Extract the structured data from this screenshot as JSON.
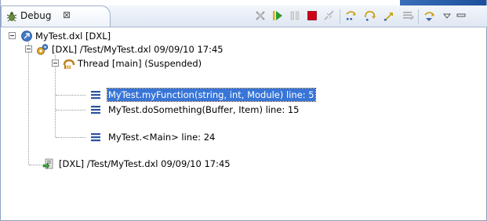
{
  "colors": {
    "selection": "#3875d7",
    "frame_border": "#8da2c0",
    "tabbar": "#dfe7f3",
    "terminate": "#d0021b",
    "resume": "#2e9a2e"
  },
  "view": {
    "tab_label": "Debug",
    "tab_close_glyph": "⊠"
  },
  "toolbar": {
    "buttons": [
      {
        "name": "remove-terminated-icon"
      },
      {
        "name": "resume-icon"
      },
      {
        "name": "suspend-icon"
      },
      {
        "name": "terminate-icon"
      },
      {
        "name": "disconnect-icon"
      },
      {
        "name": "step-into-icon"
      },
      {
        "name": "step-over-icon"
      },
      {
        "name": "step-return-icon"
      },
      {
        "name": "drop-to-frame-icon"
      },
      {
        "name": "use-step-filters-icon"
      },
      {
        "name": "view-menu-icon"
      },
      {
        "name": "minimize-icon"
      }
    ]
  },
  "tree": {
    "launch": {
      "label": "MyTest.dxl [DXL]",
      "icon": "launch-config-icon"
    },
    "debug_target": {
      "label": "[DXL] /Test/MyTest.dxl 09/09/10 17:45",
      "icon": "debug-target-icon"
    },
    "thread": {
      "label": "Thread [main] (Suspended)",
      "icon": "thread-suspended-icon"
    },
    "frames": [
      {
        "label": "MyTest.myFunction(string, int, Module) line: 5",
        "selected": true
      },
      {
        "label": "MyTest.doSomething(Buffer, Item) line: 15",
        "selected": false
      },
      {
        "label": "MyTest.<Main> line: 24",
        "selected": false
      }
    ],
    "process": {
      "label": "[DXL] /Test/MyTest.dxl 09/09/10 17:45",
      "icon": "process-icon"
    }
  }
}
